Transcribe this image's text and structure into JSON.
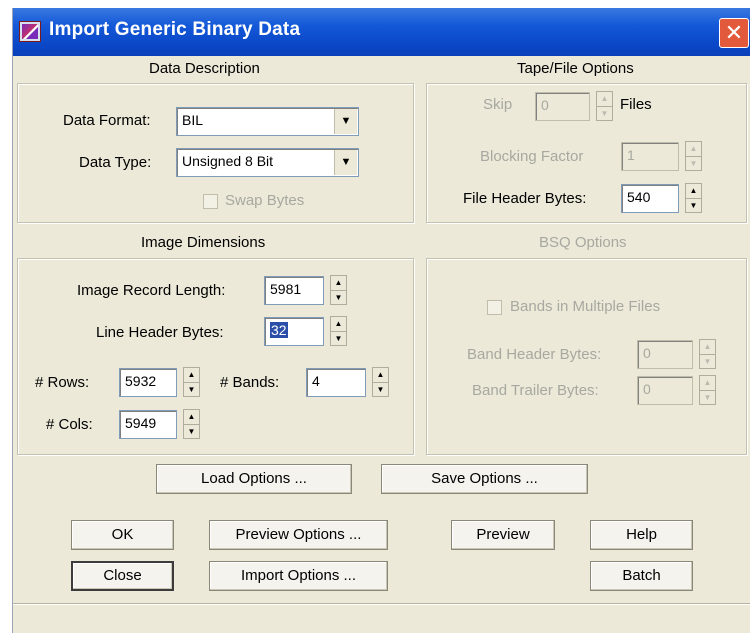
{
  "window": {
    "title": "Import Generic Binary Data"
  },
  "data_description": {
    "header": "Data Description",
    "data_format_label": "Data Format:",
    "data_format_value": "BIL",
    "data_type_label": "Data Type:",
    "data_type_value": "Unsigned 8 Bit",
    "swap_bytes_label": "Swap Bytes",
    "swap_bytes_checked": false
  },
  "tape_options": {
    "header": "Tape/File Options",
    "skip_label": "Skip",
    "skip_value": "0",
    "files_label": "Files",
    "blocking_label": "Blocking Factor",
    "blocking_value": "1",
    "file_header_label": "File Header Bytes:",
    "file_header_value": "540"
  },
  "image_dimensions": {
    "header": "Image Dimensions",
    "record_length_label": "Image Record Length:",
    "record_length_value": "5981",
    "line_header_label": "Line Header Bytes:",
    "line_header_value": "32",
    "rows_label": "# Rows:",
    "rows_value": "5932",
    "bands_label": "# Bands:",
    "bands_value": "4",
    "cols_label": "# Cols:",
    "cols_value": "5949"
  },
  "bsq_options": {
    "header": "BSQ Options",
    "multiple_files_label": "Bands in Multiple Files",
    "band_header_label": "Band Header Bytes:",
    "band_header_value": "0",
    "band_trailer_label": "Band Trailer Bytes:",
    "band_trailer_value": "0"
  },
  "buttons": {
    "load_options": "Load Options ...",
    "save_options": "Save Options ...",
    "ok": "OK",
    "preview_options": "Preview Options ...",
    "preview": "Preview",
    "help": "Help",
    "close": "Close",
    "import_options": "Import Options ...",
    "batch": "Batch"
  },
  "colors": {
    "titlebar": "#0a46c6",
    "dialog_bg": "#ece9d8",
    "disabled_text": "#a8a8a0",
    "selection": "#2b4fa8"
  }
}
